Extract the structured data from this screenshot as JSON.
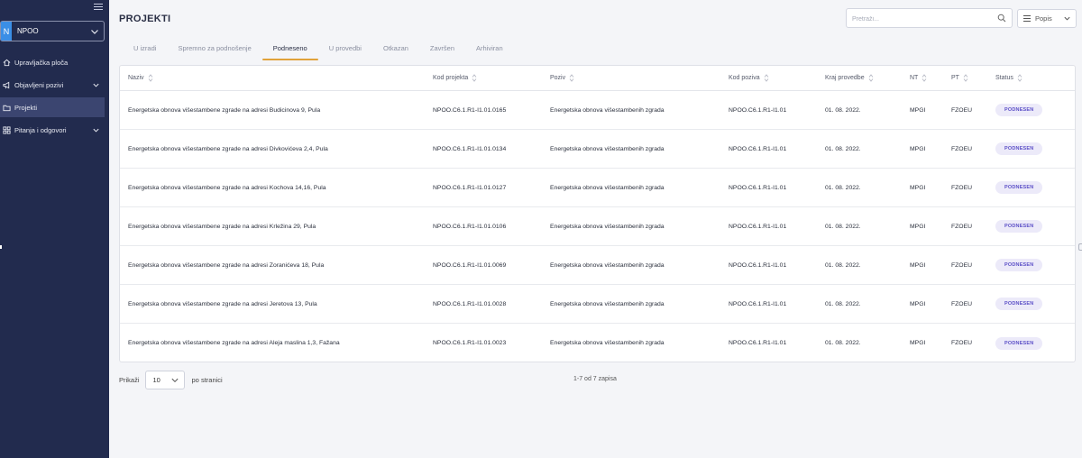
{
  "sidebar": {
    "org_badge": "N",
    "org_name": "NPOO",
    "items": [
      {
        "label": "Upravljačka ploča",
        "icon": "home-icon",
        "has_children": false,
        "active": false
      },
      {
        "label": "Objavljeni pozivi",
        "icon": "megaphone-icon",
        "has_children": true,
        "active": false
      },
      {
        "label": "Projekti",
        "icon": "folder-icon",
        "has_children": false,
        "active": true
      },
      {
        "label": "Pitanja i odgovori",
        "icon": "qa-icon",
        "has_children": true,
        "active": false
      }
    ]
  },
  "header": {
    "title": "PROJEKTI",
    "search_placeholder": "Pretraži...",
    "view_label": "Popis"
  },
  "tabs": [
    {
      "label": "U izradi",
      "active": false
    },
    {
      "label": "Spremno za podnošenje",
      "active": false
    },
    {
      "label": "Podneseno",
      "active": true
    },
    {
      "label": "U provedbi",
      "active": false
    },
    {
      "label": "Otkazan",
      "active": false
    },
    {
      "label": "Završen",
      "active": false
    },
    {
      "label": "Arhiviran",
      "active": false
    }
  ],
  "table": {
    "columns": [
      "Naziv",
      "Kod projekta",
      "Poziv",
      "Kod poziva",
      "Kraj provedbe",
      "NT",
      "PT",
      "Status"
    ],
    "rows": [
      [
        "Energetska obnova višestambene zgrade na adresi Budicinova 9, Pula",
        "NPOO.C6.1.R1-I1.01.0165",
        "Energetska obnova višestambenih zgrada",
        "NPOO.C6.1.R1-I1.01",
        "01. 08. 2022.",
        "MPGI",
        "FZOEU",
        "PODNESEN"
      ],
      [
        "Energetska obnova višestambene zgrade na adresi Divkovićeva 2,4, Pula",
        "NPOO.C6.1.R1-I1.01.0134",
        "Energetska obnova višestambenih zgrada",
        "NPOO.C6.1.R1-I1.01",
        "01. 08. 2022.",
        "MPGI",
        "FZOEU",
        "PODNESEN"
      ],
      [
        "Energetska obnova višestambene zgrade na adresi Kochova 14,16, Pula",
        "NPOO.C6.1.R1-I1.01.0127",
        "Energetska obnova višestambenih zgrada",
        "NPOO.C6.1.R1-I1.01",
        "01. 08. 2022.",
        "MPGI",
        "FZOEU",
        "PODNESEN"
      ],
      [
        "Energetska obnova višestambene zgrade na adresi Krležina 29, Pula",
        "NPOO.C6.1.R1-I1.01.0106",
        "Energetska obnova višestambenih zgrada",
        "NPOO.C6.1.R1-I1.01",
        "01. 08. 2022.",
        "MPGI",
        "FZOEU",
        "PODNESEN"
      ],
      [
        "Energetska obnova višestambene zgrade na adresi Zoranićeva 18, Pula",
        "NPOO.C6.1.R1-I1.01.0069",
        "Energetska obnova višestambenih zgrada",
        "NPOO.C6.1.R1-I1.01",
        "01. 08. 2022.",
        "MPGI",
        "FZOEU",
        "PODNESEN"
      ],
      [
        "Energetska obnova višestambene zgrade na adresi Jeretova 13, Pula",
        "NPOO.C6.1.R1-I1.01.0028",
        "Energetska obnova višestambenih zgrada",
        "NPOO.C6.1.R1-I1.01",
        "01. 08. 2022.",
        "MPGI",
        "FZOEU",
        "PODNESEN"
      ],
      [
        "Energetska obnova višestambene zgrade na adresi Aleja maslina 1,3, Fažana",
        "NPOO.C6.1.R1-I1.01.0023",
        "Energetska obnova višestambenih zgrada",
        "NPOO.C6.1.R1-I1.01",
        "01. 08. 2022.",
        "MPGI",
        "FZOEU",
        "PODNESEN"
      ]
    ]
  },
  "footer": {
    "per_page_label": "Prikaži",
    "per_page_value": "10",
    "per_page_suffix": "po stranici",
    "records": "1-7 od 7 zapisa"
  },
  "colors": {
    "sidebar_bg": "#222b4e",
    "accent_tab": "#e0a23a",
    "badge_text": "#5b4fc7",
    "badge_bg": "#eceaf9"
  }
}
